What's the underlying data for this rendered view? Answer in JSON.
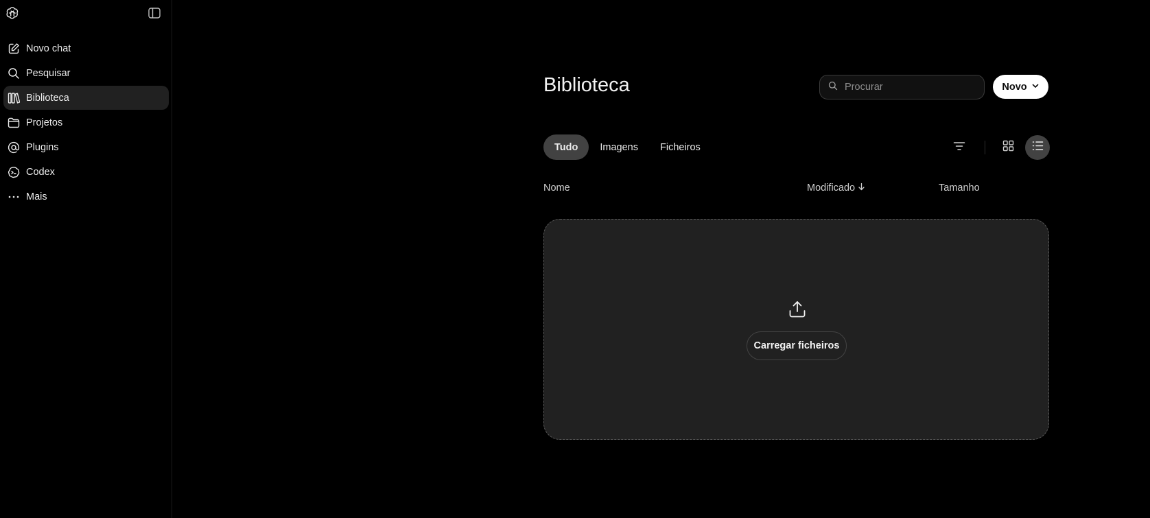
{
  "sidebar": {
    "items": [
      {
        "label": "Novo chat",
        "icon": "edit-icon"
      },
      {
        "label": "Pesquisar",
        "icon": "search-icon"
      },
      {
        "label": "Biblioteca",
        "icon": "library-icon",
        "active": true
      },
      {
        "label": "Projetos",
        "icon": "folder-icon"
      },
      {
        "label": "Plugins",
        "icon": "at-icon"
      },
      {
        "label": "Codex",
        "icon": "codex-icon"
      },
      {
        "label": "Mais",
        "icon": "more-icon"
      }
    ]
  },
  "main": {
    "title": "Biblioteca",
    "search": {
      "placeholder": "Procurar",
      "value": ""
    },
    "new_button": "Novo",
    "tabs": [
      {
        "label": "Tudo",
        "active": true
      },
      {
        "label": "Imagens",
        "active": false
      },
      {
        "label": "Ficheiros",
        "active": false
      }
    ],
    "columns": {
      "name": "Nome",
      "modified": "Modificado",
      "size": "Tamanho"
    },
    "dropzone": {
      "upload_label": "Carregar ficheiros"
    }
  },
  "colors": {
    "background": "#000000",
    "surface": "#212121",
    "active_tab": "#424242",
    "text": "#ececec",
    "primary_button_bg": "#ffffff"
  }
}
